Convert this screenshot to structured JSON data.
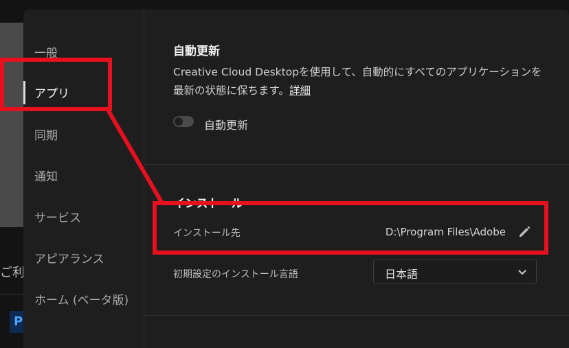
{
  "background": {
    "partial_text": "ご利",
    "badge_letter": "P"
  },
  "sidebar": {
    "items": [
      {
        "label": "一般"
      },
      {
        "label": "アプリ",
        "active": true
      },
      {
        "label": "同期"
      },
      {
        "label": "通知"
      },
      {
        "label": "サービス"
      },
      {
        "label": "アピアランス"
      },
      {
        "label": "ホーム (ベータ版)"
      }
    ]
  },
  "auto_update": {
    "title": "自動更新",
    "description": "Creative Cloud Desktopを使用して、自動的にすべてのアプリケーションを最新の状態に保ちます。",
    "link": "詳細",
    "toggle_label": "自動更新",
    "toggle_on": false
  },
  "install": {
    "title": "インストール",
    "location_label": "インストール先",
    "location_value": "D:\\Program Files\\Adobe",
    "language_label": "初期設定のインストール言語",
    "language_value": "日本語"
  },
  "annotation_color": "#e6101e",
  "icons": [
    "pencil-icon",
    "chevron-down-icon"
  ]
}
